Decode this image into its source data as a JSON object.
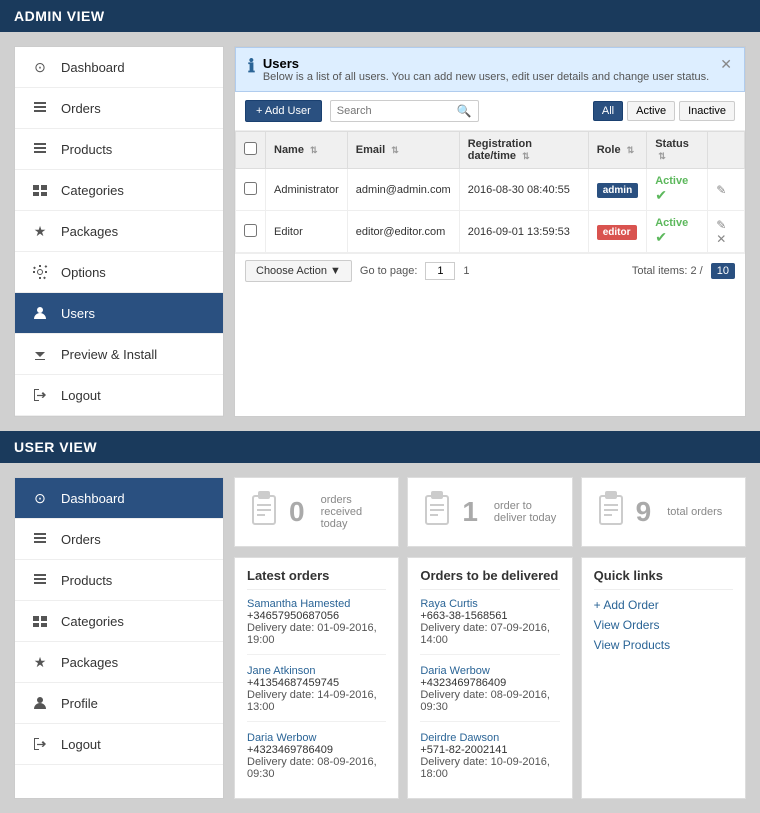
{
  "admin_section": {
    "header": "ADMIN VIEW",
    "sidebar": {
      "items": [
        {
          "label": "Dashboard",
          "icon": "⊙",
          "active": false
        },
        {
          "label": "Orders",
          "icon": "≡",
          "active": false
        },
        {
          "label": "Products",
          "icon": "≡",
          "active": false
        },
        {
          "label": "Categories",
          "icon": "📁",
          "active": false
        },
        {
          "label": "Packages",
          "icon": "★",
          "active": false
        },
        {
          "label": "Options",
          "icon": "🔧",
          "active": false
        },
        {
          "label": "Users",
          "icon": "👤",
          "active": true
        },
        {
          "label": "Preview & Install",
          "icon": "⬇",
          "active": false
        },
        {
          "label": "Logout",
          "icon": "↩",
          "active": false
        }
      ]
    },
    "panel": {
      "title": "Users",
      "subtitle": "Below is a list of all users. You can add new users, edit user details and change user status.",
      "add_user_label": "+ Add User",
      "search_placeholder": "Search",
      "filter_all": "All",
      "filter_active": "Active",
      "filter_inactive": "Inactive",
      "table": {
        "columns": [
          "Name",
          "Email",
          "Registration date/time",
          "Role",
          "Status"
        ],
        "rows": [
          {
            "name": "Administrator",
            "email": "admin@admin.com",
            "reg_date": "2016-08-30 08:40:55",
            "role": "admin",
            "role_class": "badge-admin",
            "status": "Active"
          },
          {
            "name": "Editor",
            "email": "editor@editor.com",
            "reg_date": "2016-09-01 13:59:53",
            "role": "editor",
            "role_class": "badge-editor",
            "status": "Active"
          }
        ]
      },
      "choose_action": "Choose Action ▼",
      "go_to_page": "Go to page:",
      "page_num": "1",
      "page_of": "1",
      "total_label": "Total items: 2 /",
      "total_count": "10"
    }
  },
  "user_section": {
    "header": "USER VIEW",
    "sidebar": {
      "items": [
        {
          "label": "Dashboard",
          "icon": "⊙",
          "active": true
        },
        {
          "label": "Orders",
          "icon": "≡",
          "active": false
        },
        {
          "label": "Products",
          "icon": "≡",
          "active": false
        },
        {
          "label": "Categories",
          "icon": "📁",
          "active": false
        },
        {
          "label": "Packages",
          "icon": "★",
          "active": false
        },
        {
          "label": "Profile",
          "icon": "👤",
          "active": false
        },
        {
          "label": "Logout",
          "icon": "↩",
          "active": false
        }
      ]
    },
    "stats": [
      {
        "number": "0",
        "label": "orders received today"
      },
      {
        "number": "1",
        "label": "order to deliver today"
      },
      {
        "number": "9",
        "label": "total orders"
      }
    ],
    "latest_orders": {
      "title": "Latest orders",
      "orders": [
        {
          "name": "Samantha Hamested",
          "phone": "+34657950687056",
          "date": "Delivery date: 01-09-2016, 19:00"
        },
        {
          "name": "Jane Atkinson",
          "phone": "+41354687459745",
          "date": "Delivery date: 14-09-2016, 13:00"
        },
        {
          "name": "Daria Werbow",
          "phone": "+4323469786409",
          "date": "Delivery date: 08-09-2016, 09:30"
        }
      ]
    },
    "orders_to_deliver": {
      "title": "Orders to be delivered",
      "orders": [
        {
          "name": "Raya Curtis",
          "phone": "+663-38-1568561",
          "date": "Delivery date: 07-09-2016, 14:00"
        },
        {
          "name": "Daria Werbow",
          "phone": "+4323469786409",
          "date": "Delivery date: 08-09-2016, 09:30"
        },
        {
          "name": "Deirdre Dawson",
          "phone": "+571-82-2002141",
          "date": "Delivery date: 10-09-2016, 18:00"
        }
      ]
    },
    "quick_links": {
      "title": "Quick links",
      "links": [
        "+ Add Order",
        "View Orders",
        "View Products"
      ]
    }
  }
}
